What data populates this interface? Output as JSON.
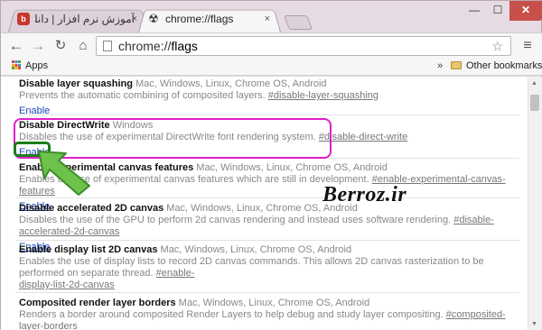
{
  "tabs": [
    {
      "title": "آموزش نرم افزار | دانلود, سا",
      "close": "×",
      "favicon": "b"
    },
    {
      "title": "chrome://flags",
      "close": "×",
      "favicon": "☢"
    }
  ],
  "window_controls": {
    "minimize": "—",
    "maximize": "☐",
    "close": "✕"
  },
  "toolbar": {
    "back": "←",
    "forward": "→",
    "reload": "↻",
    "home": "⌂",
    "url_scheme": "chrome://",
    "url_path": "flags",
    "star": "☆",
    "menu": "≡"
  },
  "bookmarks": {
    "apps": "Apps",
    "overflow": "»",
    "other": "Other bookmarks"
  },
  "flags": [
    {
      "title": "Disable layer squashing",
      "platforms": "Mac, Windows, Linux, Chrome OS, Android",
      "desc": "Prevents the automatic combining of composited layers. ",
      "hash": "#disable-layer-squashing",
      "desc2": "",
      "hash2": "",
      "action": "Enable"
    },
    {
      "title": "Disable DirectWrite",
      "platforms": "Windows",
      "desc": "Disables the use of experimental DirectWrite font rendering system. ",
      "hash": "#disable-direct-write",
      "desc2": "",
      "hash2": "",
      "action": "Enable"
    },
    {
      "title": "Enable experimental canvas features",
      "platforms": "Mac, Windows, Linux, Chrome OS, Android",
      "desc": "Enables the use of experimental canvas features which are still in development. ",
      "hash": "#enable-experimental-canvas-features",
      "desc2": "",
      "hash2": "",
      "action": "Enable"
    },
    {
      "title": "Disable accelerated 2D canvas",
      "platforms": "Mac, Windows, Linux, Chrome OS, Android",
      "desc": "Disables the use of the GPU to perform 2d canvas rendering and instead uses software rendering. ",
      "hash": "#disable-accelerated-2d-canvas",
      "desc2": "",
      "hash2": "",
      "action": "Enable"
    },
    {
      "title": "Enable display list 2D canvas",
      "platforms": "Mac, Windows, Linux, Chrome OS, Android",
      "desc": "Enables the use of display lists to record 2D canvas commands. This allows 2D canvas rasterization to be performed on separate thread. ",
      "hash": "#enable-",
      "desc2": "",
      "hash2": "display-list-2d-canvas",
      "action": "Enable"
    },
    {
      "title": "Composited render layer borders",
      "platforms": "Mac, Windows, Linux, Chrome OS, Android",
      "desc": "Renders a border around composited Render Layers to help debug and study layer compositing. ",
      "hash": "#composited-layer-borders",
      "desc2": "",
      "hash2": "",
      "action": ""
    }
  ],
  "annotation": {
    "watermark": "Berroz.ir",
    "highlight_color": "#e01fc6",
    "enable_box_color": "#1b7e1b",
    "arrow_color": "#6cc24a"
  },
  "scrollbar": {
    "up": "▲",
    "down": "▼"
  }
}
